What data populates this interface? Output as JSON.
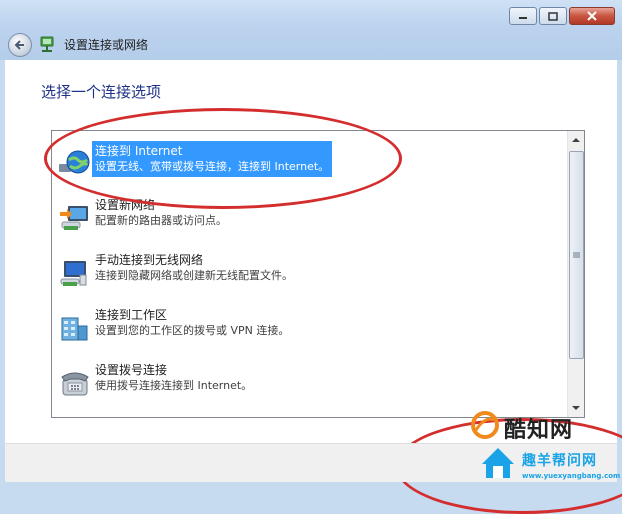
{
  "window": {
    "title": "设置连接或网络",
    "minimize_icon": "minimize-icon",
    "maximize_icon": "maximize-icon",
    "close_icon": "close-icon"
  },
  "heading": "选择一个连接选项",
  "options": [
    {
      "title": "连接到 Internet",
      "desc": "设置无线、宽带或拨号连接，连接到 Internet。",
      "icon": "globe-network-icon",
      "selected": true
    },
    {
      "title": "设置新网络",
      "desc": "配置新的路由器或访问点。",
      "icon": "new-network-icon",
      "selected": false
    },
    {
      "title": "手动连接到无线网络",
      "desc": "连接到隐藏网络或创建新无线配置文件。",
      "icon": "wireless-network-icon",
      "selected": false
    },
    {
      "title": "连接到工作区",
      "desc": "设置到您的工作区的拨号或 VPN 连接。",
      "icon": "workplace-icon",
      "selected": false
    },
    {
      "title": "设置拨号连接",
      "desc": "使用拨号连接连接到 Internet。",
      "icon": "phone-icon",
      "selected": false
    }
  ],
  "watermark": {
    "brand": "酷知网",
    "sub": "趣羊帮问网",
    "url": "www.yuexyangbang.com"
  },
  "colors": {
    "selection": "#3399ff",
    "heading": "#1e3287",
    "annotation": "#d42d2d"
  }
}
